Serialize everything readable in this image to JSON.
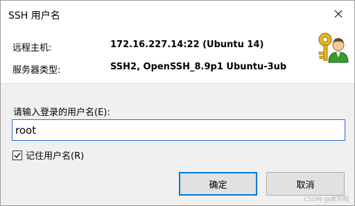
{
  "window": {
    "title": "SSH 用户名",
    "close_icon": "close-icon"
  },
  "info": {
    "host_label": "远程主机:",
    "host_value": "172.16.227.14:22 (Ubuntu  14)",
    "server_label": "服务器类型:",
    "server_value": "SSH2, OpenSSH_8.9p1 Ubuntu-3ub",
    "icon": "key-user-icon"
  },
  "form": {
    "prompt": "请输入登录的用户名(E):",
    "username_value": "root",
    "remember_label": "记住用户名(R)",
    "remember_checked": true
  },
  "buttons": {
    "ok_label": "确定",
    "cancel_label": "取消"
  },
  "colors": {
    "accent": "#0078d7",
    "input_border": "#2f6bd8"
  },
  "watermark": "CSDN @故苏喝"
}
